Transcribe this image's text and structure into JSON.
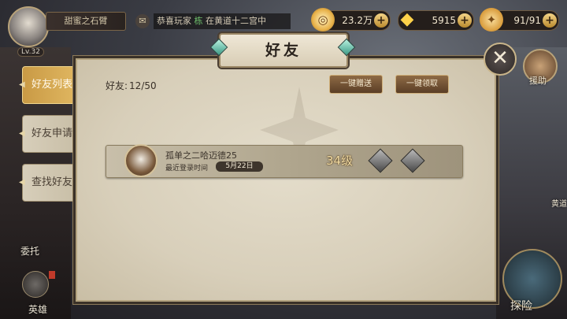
{
  "player": {
    "name": "甜蜜之石臂",
    "level": "Lv.32"
  },
  "chat": {
    "prefix": "恭喜玩家",
    "highlight": "栋",
    "text": "在黄道十二宫中"
  },
  "resources": {
    "gold": {
      "value": "23.2万",
      "icon": "gold-coin-icon"
    },
    "gems": {
      "value": "5915",
      "icon": "diamond-icon"
    },
    "stamina": {
      "value": "91/91",
      "icon": "stamina-icon"
    }
  },
  "tabs": [
    {
      "label": "好友列表",
      "active": true
    },
    {
      "label": "好友申请",
      "active": false
    },
    {
      "label": "查找好友",
      "active": false
    }
  ],
  "panel": {
    "title": "好友",
    "count_label": "好友:",
    "count_value": "12/50",
    "send_all": "一键赠送",
    "receive_all": "一键领取"
  },
  "friends": [
    {
      "name": "孤单之二哈迈德25",
      "last_login_label": "最近登录时间",
      "last_login": "5月22日",
      "level": "34级"
    }
  ],
  "side": {
    "commission": "委托",
    "hero": "英雄",
    "help": "援助",
    "explore": "探险",
    "zodiac": "黄道"
  },
  "colors": {
    "accent": "#c99a45",
    "panel": "#d8cfba"
  }
}
